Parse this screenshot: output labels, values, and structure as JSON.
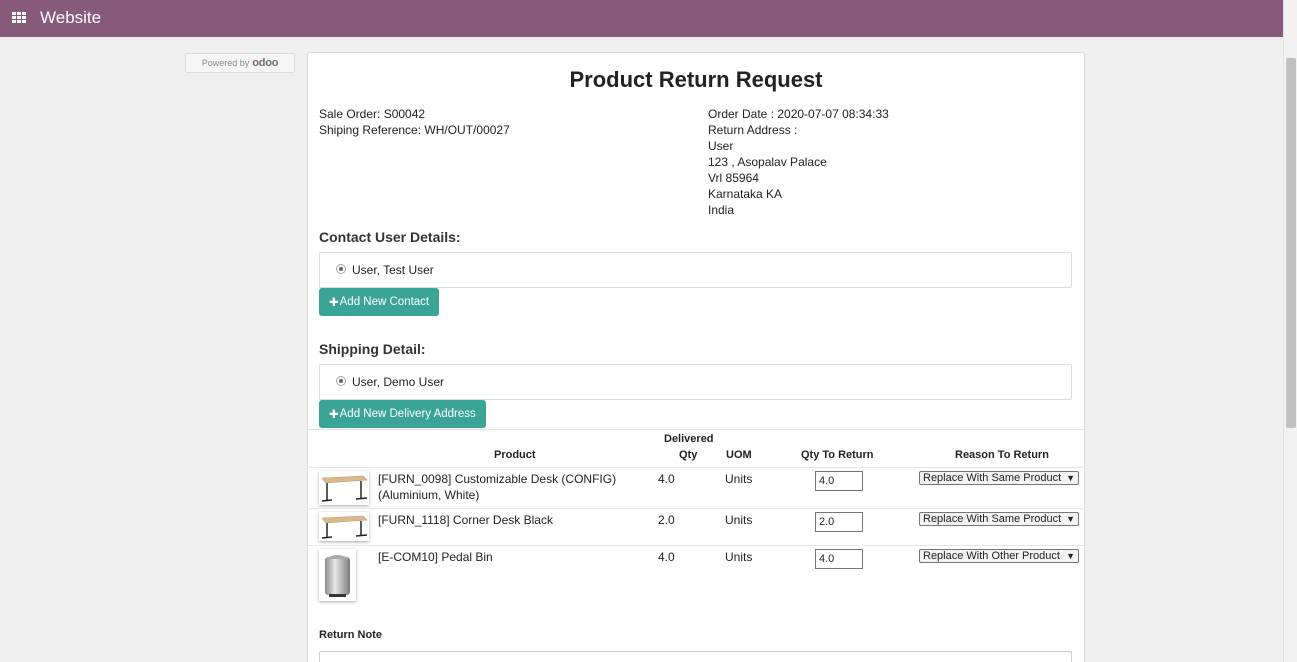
{
  "app": {
    "title": "Website"
  },
  "powered": {
    "prefix": "Powered by",
    "brand_o": "o",
    "brand_rest": "doo"
  },
  "page": {
    "title": "Product Return Request"
  },
  "order": {
    "sale_order": "Sale Order: S00042",
    "shipping_reference": "Shiping Reference: WH/OUT/00027",
    "order_date": "Order Date : 2020-07-07 08:34:33",
    "return_address_label": "Return Address :",
    "address_lines": [
      "User",
      "123 , Asopalav Palace",
      "Vrl 85964",
      "Karnataka KA",
      "India"
    ]
  },
  "contact": {
    "heading": "Contact User Details:",
    "option": "User, Test User",
    "add_button": "Add New Contact"
  },
  "shipping": {
    "heading": "Shipping Detail:",
    "option": "User, Demo User",
    "add_button": "Add New Delivery Address"
  },
  "table": {
    "headers": {
      "product": "Product",
      "delivered_1": "Delivered",
      "delivered_2": "Qty",
      "uom": "UOM",
      "qty_return": "Qty To Return",
      "reason": "Reason To Return"
    },
    "rows": [
      {
        "product": "[FURN_0098] Customizable Desk (CONFIG) (Aluminium, White)",
        "delivered": "4.0",
        "uom": "Units",
        "qty_return": "4.0",
        "reason": "Replace With Same Product",
        "icon": "desk-image"
      },
      {
        "product": "[FURN_1118] Corner Desk Black",
        "delivered": "2.0",
        "uom": "Units",
        "qty_return": "2.0",
        "reason": "Replace With Same Product",
        "icon": "desk-image"
      },
      {
        "product": "[E-COM10] Pedal Bin",
        "delivered": "4.0",
        "uom": "Units",
        "qty_return": "4.0",
        "reason": "Replace With Other Product",
        "icon": "bin-image"
      }
    ]
  },
  "return_note": {
    "label": "Return Note"
  },
  "colors": {
    "topbar": "#875a7b",
    "button": "#3aa597"
  }
}
